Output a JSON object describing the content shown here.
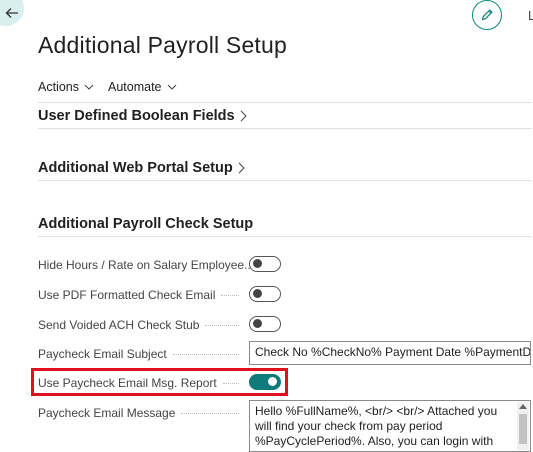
{
  "page": {
    "title": "Additional Payroll Setup",
    "cut_off_letter": "L"
  },
  "actions": [
    {
      "label": "Actions"
    },
    {
      "label": "Automate"
    }
  ],
  "sections": {
    "boolean_fields": "User Defined Boolean Fields",
    "web_portal": "Additional Web Portal Setup",
    "check_setup": "Additional Payroll Check Setup"
  },
  "fields": {
    "hide_hours": {
      "label": "Hide Hours / Rate on Salary Employee...",
      "value": false
    },
    "pdf_check_email": {
      "label": "Use PDF Formatted Check Email",
      "value": false
    },
    "voided_ach": {
      "label": "Send Voided ACH Check Stub",
      "value": false
    },
    "email_subject": {
      "label": "Paycheck Email Subject",
      "value": "Check No %CheckNo% Payment Date %PaymentDate%"
    },
    "email_msg_report": {
      "label": "Use Paycheck Email Msg. Report",
      "value": true
    },
    "email_message": {
      "label": "Paycheck Email Message",
      "value": "Hello %FullName%, <br/> <br/> Attached you will find your check from pay period %PayCyclePeriod%. Also, you can login with %Login% to the web portal"
    }
  },
  "colors": {
    "accent": "#0f7b7a",
    "highlight": "#e0101f"
  },
  "icons": {
    "back": "arrow-left-icon",
    "edit": "pencil-icon"
  }
}
